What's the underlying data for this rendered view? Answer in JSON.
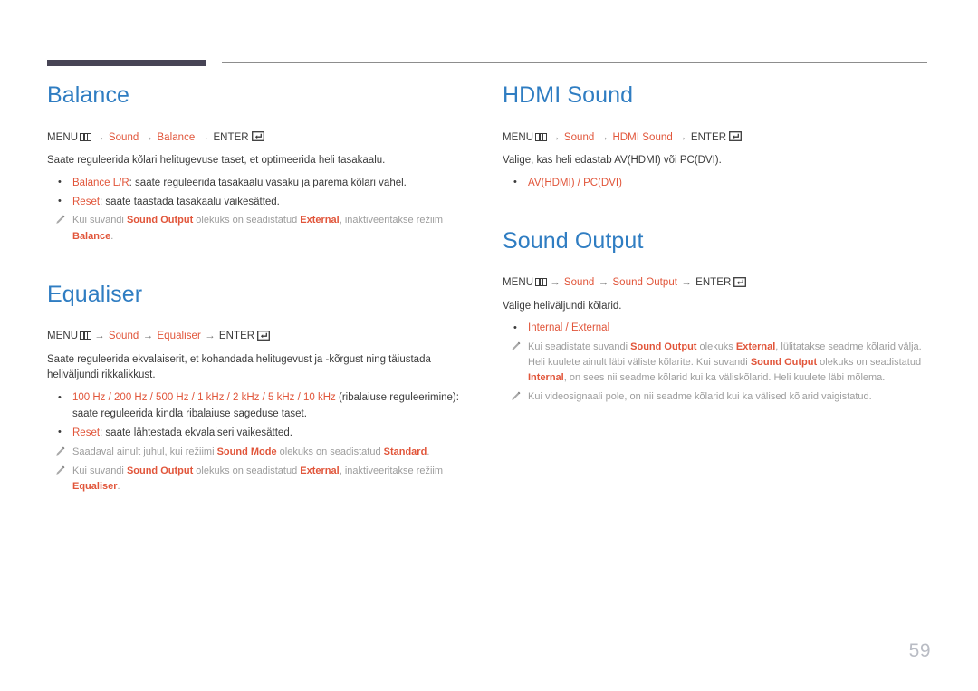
{
  "colors": {
    "heading_blue": "#2f7dc2",
    "highlight_orange": "#e1553a",
    "body_text": "#3b3b3b",
    "note_gray": "#9c9c9c",
    "rule_dark": "#474455",
    "page_number_gray": "#b9bcc4"
  },
  "page": {
    "number": "59"
  },
  "labels": {
    "menu": "MENU",
    "enter": "ENTER",
    "arrow": "→",
    "slash": " / ",
    "menu_icon_name": "menu-grid-icon",
    "enter_icon_name": "enter-return-icon",
    "note_icon_name": "pencil-note-icon"
  },
  "sections": {
    "balance": {
      "title": "Balance",
      "path": {
        "root": "MENU",
        "l1": "Sound",
        "l2": "Balance",
        "end": "ENTER"
      },
      "desc": "Saate reguleerida kõlari helitugevuse taset, et optimeerida heli tasakaalu.",
      "bullets": [
        {
          "term": "Balance L/R",
          "rest": ": saate reguleerida tasakaalu vasaku ja parema kõlari vahel."
        },
        {
          "term": "Reset",
          "rest": ": saate taastada tasakaalu vaikesätted."
        }
      ],
      "notes": [
        {
          "p1": "Kui suvandi ",
          "h1": "Sound Output",
          "p2": " olekuks on seadistatud ",
          "h2": "External",
          "p3": ", inaktiveeritakse režiim ",
          "h3": "Balance",
          "p4": "."
        }
      ]
    },
    "equaliser": {
      "title": "Equaliser",
      "path": {
        "root": "MENU",
        "l1": "Sound",
        "l2": "Equaliser",
        "end": "ENTER"
      },
      "desc": "Saate reguleerida ekvalaiserit, et kohandada helitugevust ja -kõrgust ning täiustada heliväljundi rikkalikkust.",
      "bullets": [
        {
          "term": "100 Hz / 200 Hz / 500 Hz / 1 kHz / 2 kHz / 5 kHz / 10 kHz",
          "rest": " (ribalaiuse reguleerimine): saate reguleerida kindla ribalaiuse sageduse taset."
        },
        {
          "term": "Reset",
          "rest": ": saate lähtestada ekvalaiseri vaikesätted."
        }
      ],
      "notes": [
        {
          "p1": "Saadaval ainult juhul, kui režiimi ",
          "h1": "Sound Mode",
          "p2": " olekuks on seadistatud ",
          "h2": "Standard",
          "p3": ".",
          "h3": "",
          "p4": ""
        },
        {
          "p1": "Kui suvandi ",
          "h1": "Sound Output",
          "p2": " olekuks on seadistatud ",
          "h2": "External",
          "p3": ", inaktiveeritakse režiim ",
          "h3": "Equaliser",
          "p4": "."
        }
      ]
    },
    "hdmi_sound": {
      "title": "HDMI Sound",
      "path": {
        "root": "MENU",
        "l1": "Sound",
        "l2": "HDMI Sound",
        "end": "ENTER"
      },
      "desc_p1": "Valige, kas heli edastab ",
      "desc_h1": "AV(HDMI)",
      "desc_p2": " või ",
      "desc_h2": "PC(DVI)",
      "desc_p3": ".",
      "bullets": [
        {
          "term": "AV(HDMI) / PC(DVI)",
          "rest": ""
        }
      ]
    },
    "sound_output": {
      "title": "Sound Output",
      "path": {
        "root": "MENU",
        "l1": "Sound",
        "l2": "Sound Output",
        "end": "ENTER"
      },
      "desc": "Valige heliväljundi kõlarid.",
      "bullets": [
        {
          "term": "Internal / External",
          "rest": ""
        }
      ],
      "notes": [
        {
          "p1": "Kui seadistate suvandi ",
          "h1": "Sound Output",
          "p2": " olekuks ",
          "h2": "External",
          "p3": ", lülitatakse seadme kõlarid välja. Heli kuulete ainult läbi väliste kõlarite. Kui suvandi ",
          "h3": "Sound Output",
          "p4": " olekuks on seadistatud ",
          "h4": "Internal",
          "p5": ", on sees nii seadme kõlarid kui ka väliskõlarid. Heli kuulete läbi mõlema."
        },
        {
          "p1": "Kui videosignaali pole, on nii seadme kõlarid kui ka välised kõlarid vaigistatud.",
          "h1": "",
          "p2": "",
          "h2": "",
          "p3": "",
          "h3": "",
          "p4": "",
          "h4": "",
          "p5": ""
        }
      ]
    }
  }
}
